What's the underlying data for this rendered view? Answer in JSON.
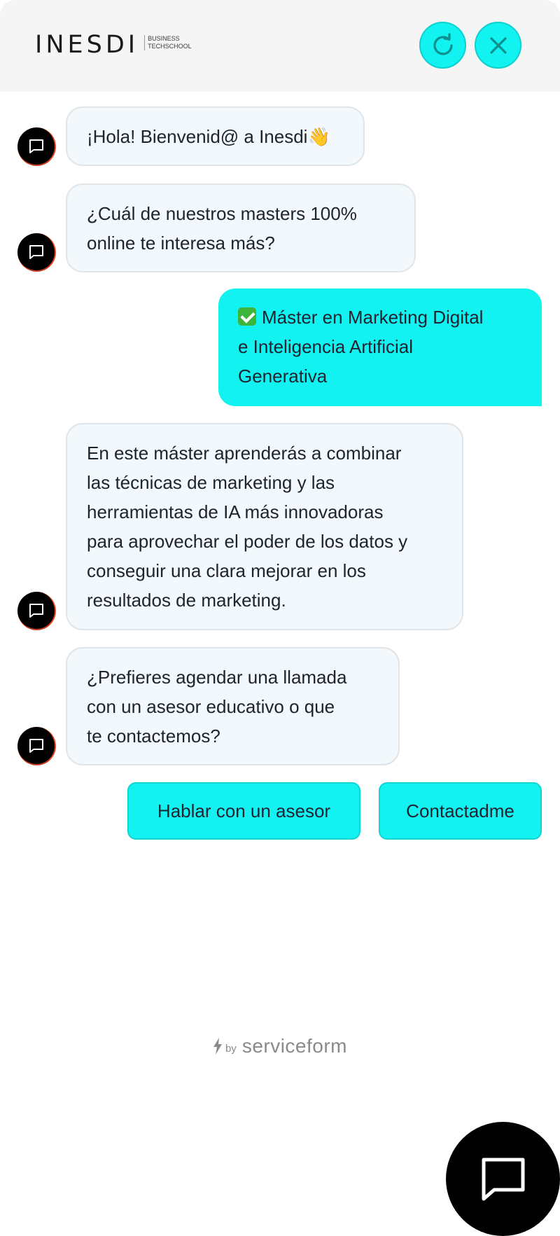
{
  "header": {
    "logo_text": "INESDI",
    "logo_sub_1": "BUSINESS",
    "logo_sub_2": "TECHSCHOOL",
    "refresh_icon": "refresh-icon",
    "close_icon": "close-icon",
    "accent_color": "#12f2f0"
  },
  "messages": [
    {
      "from": "bot",
      "lines": [
        "¡Hola! Bienvenid@ a Inesdi👋"
      ]
    },
    {
      "from": "bot",
      "lines": [
        "¿Cuál de nuestros masters 100%",
        "online te interesa más?"
      ]
    },
    {
      "from": "user",
      "lines": [
        "Máster en Marketing Digital",
        "e Inteligencia Artificial",
        "Generativa"
      ]
    },
    {
      "from": "bot",
      "lines": [
        "En este máster aprenderás a combinar",
        "las técnicas de marketing y las",
        "herramientas de IA más innovadoras",
        "para aprovechar el poder de los datos y",
        "conseguir una clara mejorar en los",
        "resultados de marketing."
      ]
    },
    {
      "from": "bot",
      "lines": [
        "¿Prefieres agendar una llamada",
        "con un asesor educativo o que",
        "te contactemos?"
      ]
    }
  ],
  "options": {
    "advisor": "Hablar con un asesor",
    "contact": "Contactadme"
  },
  "footer": {
    "by": "by",
    "brand": "serviceform"
  },
  "launcher": {
    "icon": "chat-bubble-icon"
  }
}
